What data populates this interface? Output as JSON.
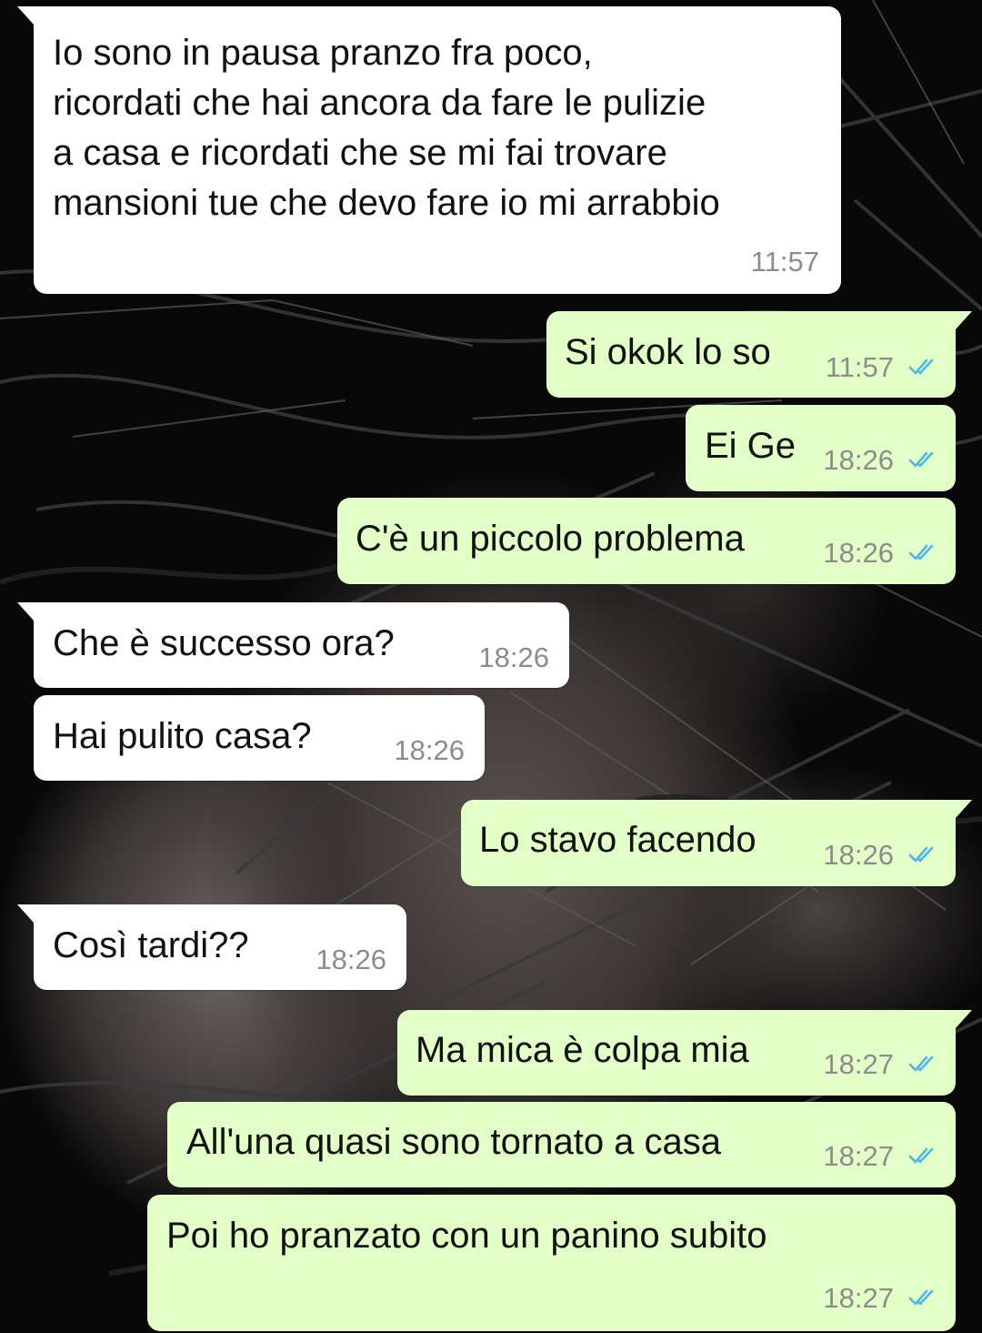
{
  "theme": {
    "incoming_bubble": "#ffffff",
    "outgoing_bubble": "#e2ffc7",
    "timestamp_color": "#8c8c8c",
    "read_ticks_color": "#4fb6ec"
  },
  "messages": [
    {
      "direction": "incoming",
      "text": "Io sono in pausa pranzo fra poco,\nricordati che hai ancora da fare le pulizie\na casa e ricordati che se mi fai trovare\nmansioni tue che devo fare io mi arrabbio",
      "time": "11:57"
    },
    {
      "direction": "outgoing",
      "text": "Si okok lo so",
      "time": "11:57",
      "status": "read-ticks-icon"
    },
    {
      "direction": "outgoing",
      "text": "Ei Ge",
      "time": "18:26",
      "status": "read-ticks-icon"
    },
    {
      "direction": "outgoing",
      "text": "C'è un piccolo problema",
      "time": "18:26",
      "status": "read-ticks-icon"
    },
    {
      "direction": "incoming",
      "text": "Che è successo ora?",
      "time": "18:26"
    },
    {
      "direction": "incoming",
      "text": "Hai pulito casa?",
      "time": "18:26"
    },
    {
      "direction": "outgoing",
      "text": "Lo stavo facendo",
      "time": "18:26",
      "status": "read-ticks-icon"
    },
    {
      "direction": "incoming",
      "text": "Così tardi??",
      "time": "18:26"
    },
    {
      "direction": "outgoing",
      "text": "Ma mica è colpa mia",
      "time": "18:27",
      "status": "read-ticks-icon"
    },
    {
      "direction": "outgoing",
      "text": "All'una quasi sono tornato a casa",
      "time": "18:27",
      "status": "read-ticks-icon"
    },
    {
      "direction": "outgoing",
      "text": "Poi ho pranzato con un panino subito",
      "time": "18:27",
      "status": "read-ticks-icon"
    }
  ]
}
